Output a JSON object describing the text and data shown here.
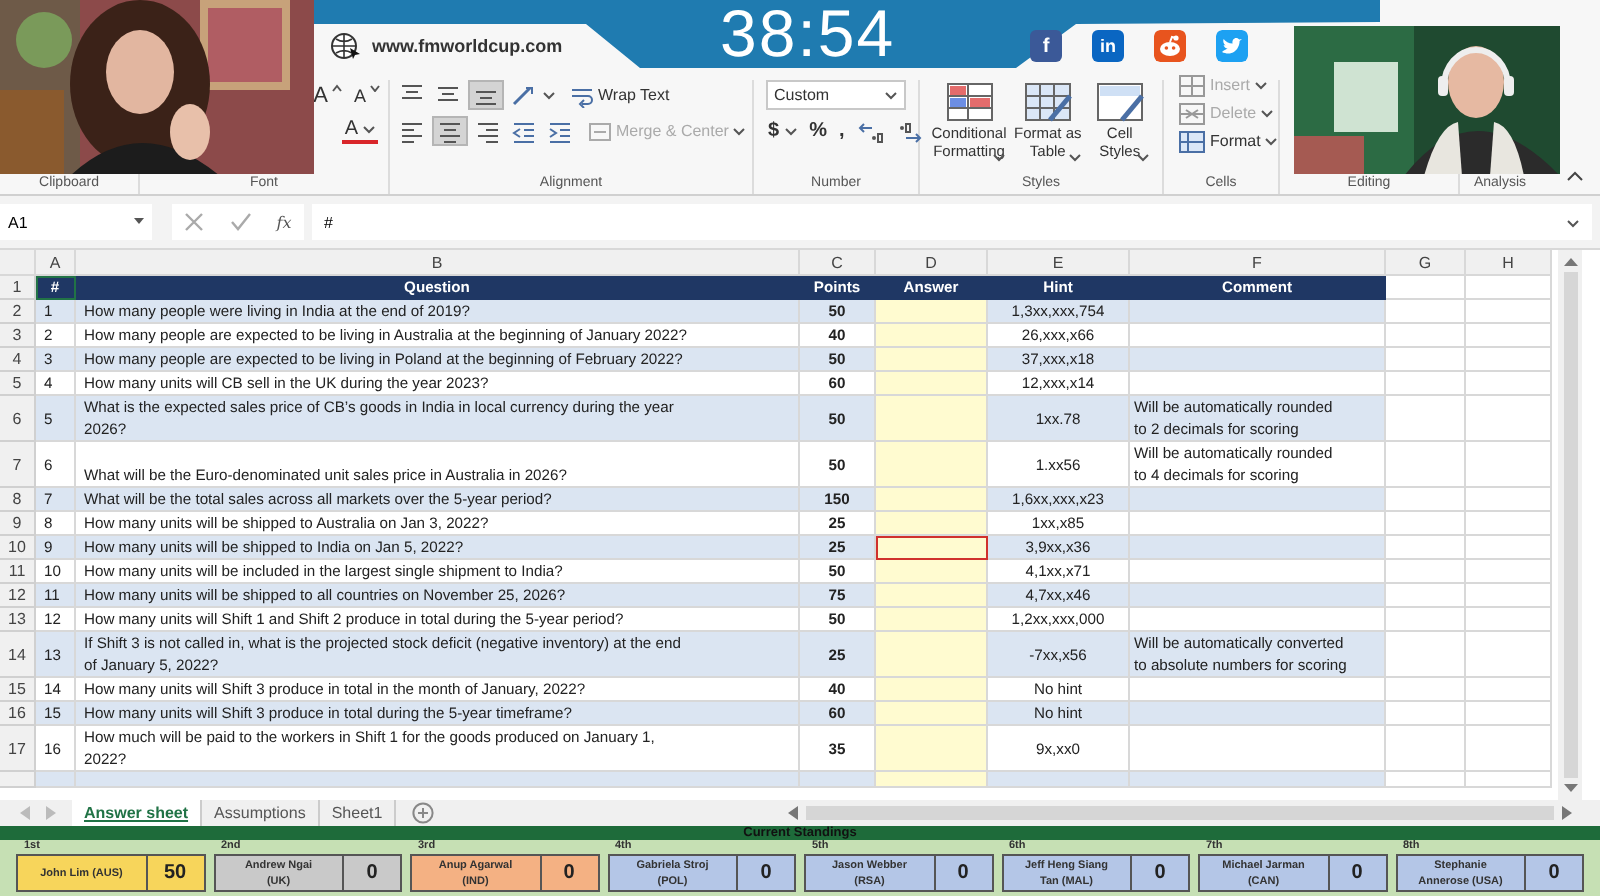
{
  "banner": {
    "timer": "38:54",
    "url": "www.fmworldcup.com",
    "social": [
      {
        "kind": "facebook",
        "label": "f"
      },
      {
        "kind": "linkedin",
        "label": "in"
      },
      {
        "kind": "reddit"
      },
      {
        "kind": "twitter"
      }
    ]
  },
  "ribbon": {
    "groups": [
      {
        "label": "Clipboard"
      },
      {
        "label": "Font",
        "rows": [
          [
            {
              "kind": "grow-font",
              "label": "A"
            },
            {
              "kind": "shrink-font",
              "label": "A"
            }
          ],
          [
            {
              "kind": "font-color",
              "label": "A"
            }
          ]
        ]
      },
      {
        "label": "Alignment",
        "rows": [
          [
            {
              "kind": "align-top",
              "selected": false
            },
            {
              "kind": "align-middle",
              "selected": false
            },
            {
              "kind": "align-bottom",
              "selected": true
            },
            {
              "kind": "orientation"
            },
            {
              "kind": "wrap",
              "label": "Wrap Text",
              "disabled": false
            }
          ],
          [
            {
              "kind": "align-left",
              "selected": false
            },
            {
              "kind": "align-center",
              "selected": true
            },
            {
              "kind": "align-right",
              "selected": false
            },
            {
              "kind": "indent-less"
            },
            {
              "kind": "indent-more"
            },
            {
              "kind": "merge",
              "label": "Merge & Center",
              "disabled": true
            }
          ]
        ]
      },
      {
        "label": "Number",
        "rows": [
          [
            {
              "kind": "dropdown",
              "label": "Custom"
            }
          ],
          [
            {
              "kind": "text-caret",
              "label": "$"
            },
            {
              "kind": "text",
              "label": "%"
            },
            {
              "kind": "text",
              "label": ","
            },
            {
              "kind": "decimal-more"
            },
            {
              "kind": "decimal-less"
            }
          ]
        ]
      },
      {
        "label": "Styles",
        "rows": [
          [
            {
              "kind": "conditional",
              "label": "Conditional\nFormatting"
            },
            {
              "kind": "format-table",
              "label": "Format as\nTable"
            },
            {
              "kind": "cell-styles",
              "label": "Cell\nStyles"
            }
          ]
        ]
      },
      {
        "label": "Cells",
        "rows": [
          [
            {
              "kind": "insert",
              "label": "Insert",
              "disabled": true
            }
          ],
          [
            {
              "kind": "delete",
              "label": "Delete",
              "disabled": true
            }
          ],
          [
            {
              "kind": "format",
              "label": "Format",
              "disabled": false
            }
          ]
        ]
      },
      {
        "label": "Editing"
      },
      {
        "label": "Analysis"
      }
    ]
  },
  "formula_bar": {
    "name_box": "A1",
    "function_label": "fx",
    "formula": "#"
  },
  "sheet": {
    "columns": [
      "A",
      "B",
      "C",
      "D",
      "E",
      "F",
      "G",
      "H"
    ],
    "header_row": "1",
    "header": [
      "#",
      "Question",
      "Points",
      "Answer",
      "Hint",
      "Comment"
    ],
    "rows": [
      {
        "row": "2",
        "num": "1",
        "question": "How many people were living in India at the end of 2019?",
        "points": "50",
        "hint": "1,3xx,xxx,754",
        "flagged": false
      },
      {
        "row": "3",
        "num": "2",
        "question": "How many people are expected to be living in Australia at the beginning of January 2022?",
        "points": "40",
        "hint": "26,xxx,x66",
        "flagged": false
      },
      {
        "row": "4",
        "num": "3",
        "question": "How many people are expected to be living in Poland at the beginning of February 2022?",
        "points": "50",
        "hint": "37,xxx,x18",
        "flagged": false
      },
      {
        "row": "5",
        "num": "4",
        "question": "How many units will CB sell in the UK during the year 2023?",
        "points": "60",
        "hint": "12,xxx,x14",
        "flagged": false
      },
      {
        "row": "6",
        "num": "5",
        "question": "What is the expected sales price of CB’s goods in India in local currency during the year\n2026?",
        "points": "50",
        "hint": "1xx.78",
        "comment": "Will be automatically rounded\nto 2 decimals for scoring",
        "flagged": false
      },
      {
        "row": "7",
        "num": "6",
        "question": "What will be the Euro-denominated unit sales price in Australia in 2026?",
        "points": "50",
        "hint": "1.xx56",
        "comment": "Will be automatically rounded\nto 4 decimals for scoring",
        "flagged": false
      },
      {
        "row": "8",
        "num": "7",
        "question": "What will be the total sales across all markets over the 5-year period?",
        "points": "150",
        "hint": "1,6xx,xxx,x23",
        "flagged": false
      },
      {
        "row": "9",
        "num": "8",
        "question": "How many units will be shipped to Australia on Jan 3, 2022?",
        "points": "25",
        "hint": "1xx,x85",
        "flagged": false
      },
      {
        "row": "10",
        "num": "9",
        "question": "How many units will be shipped to India on Jan 5, 2022?",
        "points": "25",
        "hint": "3,9xx,x36",
        "flagged": true
      },
      {
        "row": "11",
        "num": "10",
        "question": "How many units will be included in the largest single shipment to India?",
        "points": "50",
        "hint": "4,1xx,x71",
        "flagged": false
      },
      {
        "row": "12",
        "num": "11",
        "question": "How many units will be shipped to all countries on November 25, 2026?",
        "points": "75",
        "hint": "4,7xx,x46",
        "flagged": false
      },
      {
        "row": "13",
        "num": "12",
        "question": "How many units will Shift 1 and Shift 2 produce in total during the 5-year period?",
        "points": "50",
        "hint": "1,2xx,xxx,000",
        "flagged": false
      },
      {
        "row": "14",
        "num": "13",
        "question": "If Shift 3 is not called in, what is the projected stock deficit (negative inventory) at the end\nof January 5, 2022?",
        "points": "25",
        "hint": "-7xx,x56",
        "comment": "Will be automatically converted\nto absolute numbers for scoring",
        "flagged": false
      },
      {
        "row": "15",
        "num": "14",
        "question": "How many units will Shift 3 produce in total in the month of January, 2022?",
        "points": "40",
        "hint": "No hint",
        "flagged": false
      },
      {
        "row": "16",
        "num": "15",
        "question": "How many units will Shift 3 produce in total during the 5-year timeframe?",
        "points": "60",
        "hint": "No hint",
        "flagged": false
      },
      {
        "row": "17",
        "num": "16",
        "question": "How much will be paid to the workers in Shift 1 for the goods produced on January 1,\n2022?",
        "points": "35",
        "hint": "9x,xx0",
        "flagged": false
      }
    ],
    "tabs": [
      {
        "label": "Answer sheet",
        "selected": true
      },
      {
        "label": "Assumptions",
        "selected": false
      },
      {
        "label": "Sheet1",
        "selected": false
      }
    ]
  },
  "standings": {
    "title": "Current Standings",
    "entries": [
      {
        "rank": "1st",
        "name": "John Lim (AUS)",
        "score": "50",
        "color": "#f7d55b"
      },
      {
        "rank": "2nd",
        "name": "Andrew Ngai\n(UK)",
        "score": "0",
        "color": "#c9c9c9"
      },
      {
        "rank": "3rd",
        "name": "Anup Agarwal\n(IND)",
        "score": "0",
        "color": "#f4b183"
      },
      {
        "rank": "4th",
        "name": "Gabriela Stroj\n(POL)",
        "score": "0",
        "color": "#b4c6e7"
      },
      {
        "rank": "5th",
        "name": "Jason Webber\n(RSA)",
        "score": "0",
        "color": "#b4c6e7"
      },
      {
        "rank": "6th",
        "name": "Jeff Heng Siang\nTan (MAL)",
        "score": "0",
        "color": "#b4c6e7"
      },
      {
        "rank": "7th",
        "name": "Michael Jarman\n(CAN)",
        "score": "0",
        "color": "#b4c6e7"
      },
      {
        "rank": "8th",
        "name": "Stephanie\nAnnerose (USA)",
        "score": "0",
        "color": "#b4c6e7"
      }
    ]
  }
}
